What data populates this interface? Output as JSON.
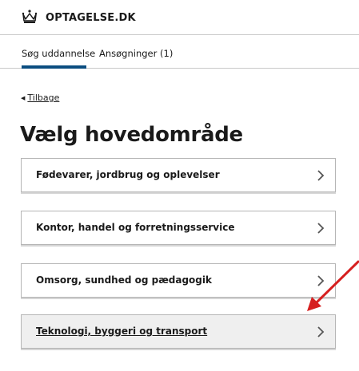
{
  "header": {
    "logo_icon": "crown-icon",
    "logo_text": "OPTAGELSE.DK"
  },
  "tabs": [
    {
      "label": "Søg uddannelse",
      "active": true
    },
    {
      "label": "Ansøgninger (1)",
      "active": false
    }
  ],
  "back": {
    "label": "Tilbage",
    "icon": "caret-left-icon"
  },
  "title": "Vælg hovedområde",
  "options": [
    {
      "label": "Fødevarer, jordbrug og oplevelser"
    },
    {
      "label": "Kontor, handel og forretningsservice"
    },
    {
      "label": "Omsorg, sundhed og pædagogik"
    },
    {
      "label": "Teknologi, byggeri og transport",
      "highlighted": true
    }
  ],
  "colors": {
    "tab_underline": "#0a4d80",
    "annotation_arrow": "#d61f1f",
    "highlight_bg": "#efefef"
  }
}
